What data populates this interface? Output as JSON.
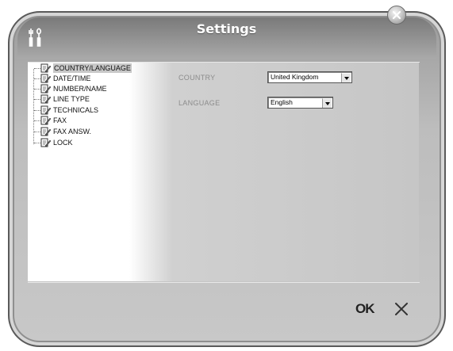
{
  "window": {
    "title": "Settings"
  },
  "tree": {
    "items": [
      {
        "label": "COUNTRY/LANGUAGE",
        "selected": true
      },
      {
        "label": "DATE/TIME"
      },
      {
        "label": "NUMBER/NAME"
      },
      {
        "label": "LINE TYPE"
      },
      {
        "label": "TECHNICALS"
      },
      {
        "label": "FAX"
      },
      {
        "label": "FAX ANSW."
      },
      {
        "label": "LOCK"
      }
    ]
  },
  "form": {
    "country_label": "COUNTRY",
    "country_value": "United Kingdom",
    "language_label": "LANGUAGE",
    "language_value": "English"
  },
  "buttons": {
    "ok_label": "OK"
  },
  "icons": {
    "tools": "tools-icon",
    "close": "close-icon",
    "tree_item": "edit-document-icon",
    "cancel": "cancel-x-icon",
    "dropdown": "chevron-down-icon"
  }
}
